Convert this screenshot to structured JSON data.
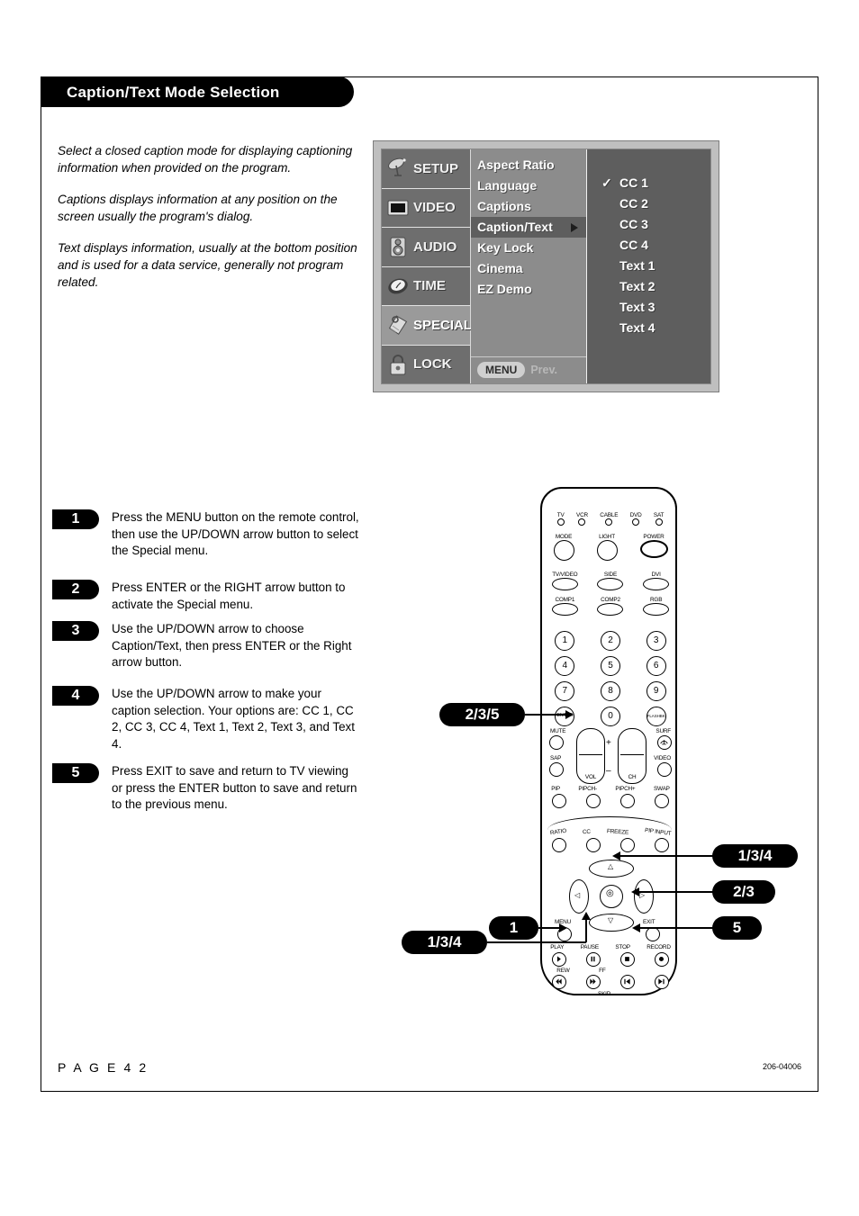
{
  "header": {
    "title": "Caption/Text Mode Selection"
  },
  "intro": [
    "Select a closed caption mode for displaying captioning information when provided on the program.",
    "Captions displays information at any position on the screen usually the program's dialog.",
    "Text displays information, usually at the bottom position and is used for a data service, generally not program related."
  ],
  "osd": {
    "sidebar": [
      {
        "label": "SETUP",
        "icon": "satellite-dish-icon",
        "active": false
      },
      {
        "label": "VIDEO",
        "icon": "screen-icon",
        "active": false
      },
      {
        "label": "AUDIO",
        "icon": "speaker-icon",
        "active": false
      },
      {
        "label": "TIME",
        "icon": "clock-icon",
        "active": false
      },
      {
        "label": "SPECIAL",
        "icon": "tag-icon",
        "active": true
      },
      {
        "label": "LOCK",
        "icon": "padlock-icon",
        "active": false
      }
    ],
    "menu": [
      {
        "label": "Aspect Ratio",
        "selected": false
      },
      {
        "label": "Language",
        "selected": false
      },
      {
        "label": "Captions",
        "selected": false
      },
      {
        "label": "Caption/Text",
        "selected": true
      },
      {
        "label": "Key Lock",
        "selected": false
      },
      {
        "label": "Cinema",
        "selected": false
      },
      {
        "label": "EZ Demo",
        "selected": false
      }
    ],
    "footer": {
      "menu_label": "MENU",
      "prev_label": "Prev."
    },
    "submenu": [
      {
        "label": "CC 1",
        "checked": true
      },
      {
        "label": "CC 2",
        "checked": false
      },
      {
        "label": "CC 3",
        "checked": false
      },
      {
        "label": "CC 4",
        "checked": false
      },
      {
        "label": "Text 1",
        "checked": false
      },
      {
        "label": "Text 2",
        "checked": false
      },
      {
        "label": "Text 3",
        "checked": false
      },
      {
        "label": "Text 4",
        "checked": false
      }
    ],
    "check_glyph": "✓"
  },
  "steps": [
    {
      "number": "1",
      "text": "Press the MENU button on the remote control, then use the UP/DOWN arrow button to select the Special menu."
    },
    {
      "number": "2",
      "text": "Press ENTER or the RIGHT arrow button to activate the Special menu."
    },
    {
      "number": "3",
      "text": "Use the UP/DOWN arrow to choose Caption/Text, then press ENTER or the Right arrow button."
    },
    {
      "number": "4",
      "text": "Use the UP/DOWN arrow to make your caption selection. Your options are: CC 1, CC 2, CC 3, CC 4, Text 1, Text 2, Text 3, and Text 4."
    },
    {
      "number": "5",
      "text": "Press EXIT to save and return to TV viewing or press the ENTER button to save and return to the previous menu."
    }
  ],
  "remote": {
    "leds": [
      "TV",
      "VCR",
      "CABLE",
      "DVD",
      "SAT"
    ],
    "row_mode": [
      "MODE",
      "LIGHT",
      "POWER"
    ],
    "row_input1": [
      "TV/VIDEO",
      "SIDE",
      "DVI"
    ],
    "row_input2": [
      "COMP1",
      "COMP2",
      "RGB"
    ],
    "keypad": [
      "1",
      "2",
      "3",
      "4",
      "5",
      "6",
      "7",
      "8",
      "9"
    ],
    "keypad_bottom": [
      "ENTER",
      "0",
      "FLASHBK"
    ],
    "row_mute": [
      "MUTE",
      "SURF"
    ],
    "row_sap": [
      "SAP",
      "VIDEO"
    ],
    "rocker_vol": "VOL",
    "rocker_ch": "CH",
    "rocker_plus": "+",
    "rocker_minus": "–",
    "row_pip": [
      "PIP",
      "PIPCH-",
      "PIPCH+",
      "SWAP"
    ],
    "row_feature": [
      "RATIO",
      "CC",
      "FREEZE",
      "PIP INPUT"
    ],
    "nav_menu": "MENU",
    "nav_exit": "EXIT",
    "row_transport": [
      "PLAY",
      "PAUSE",
      "STOP",
      "RECORD"
    ],
    "row_transport2": [
      "REW",
      "FF"
    ],
    "skip_label": "SKIP"
  },
  "callouts": [
    {
      "id": "enter",
      "label": "2/3/5"
    },
    {
      "id": "up",
      "label": "1/3/4"
    },
    {
      "id": "right",
      "label": "2/3"
    },
    {
      "id": "exit",
      "label": "5"
    },
    {
      "id": "menu",
      "label": "1"
    },
    {
      "id": "down",
      "label": "1/3/4"
    }
  ],
  "footer": {
    "page": "P A G E   4 2",
    "code": "206-04006"
  }
}
